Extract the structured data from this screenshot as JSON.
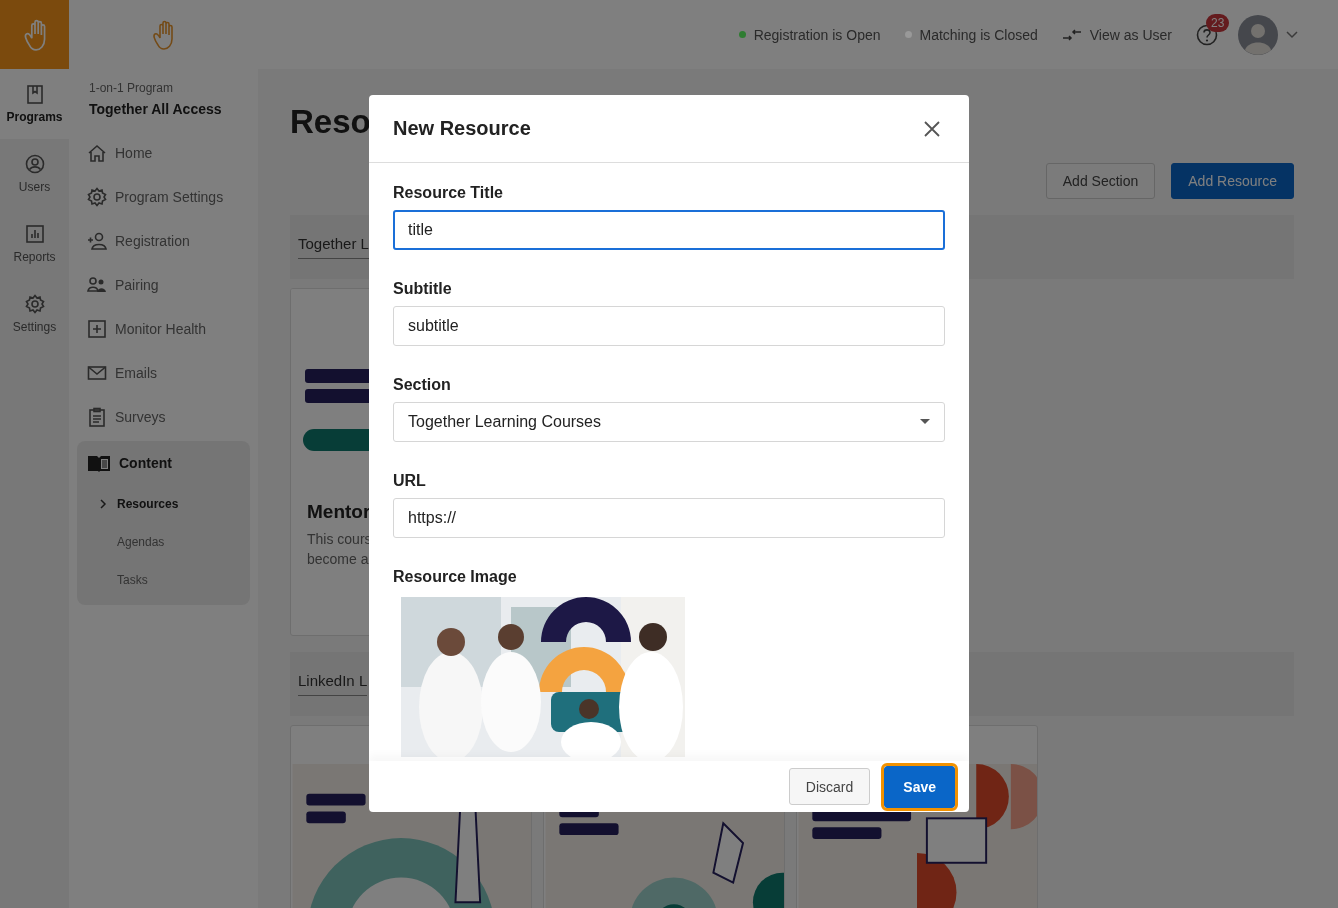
{
  "rail": {
    "items": [
      {
        "label": "Programs",
        "selected": true
      },
      {
        "label": "Users",
        "selected": false
      },
      {
        "label": "Reports",
        "selected": false
      },
      {
        "label": "Settings",
        "selected": false
      }
    ]
  },
  "nav": {
    "program_type": "1-on-1 Program",
    "program_name": "Together All Access",
    "items": [
      {
        "label": "Home",
        "selected": false
      },
      {
        "label": "Program Settings",
        "selected": false
      },
      {
        "label": "Registration",
        "selected": false
      },
      {
        "label": "Pairing",
        "selected": false
      },
      {
        "label": "Monitor Health",
        "selected": false
      },
      {
        "label": "Emails",
        "selected": false
      },
      {
        "label": "Surveys",
        "selected": false
      }
    ],
    "content_group": {
      "label": "Content",
      "expanded": true,
      "children": [
        {
          "label": "Resources",
          "selected": true
        },
        {
          "label": "Agendas",
          "selected": false
        },
        {
          "label": "Tasks",
          "selected": false
        }
      ]
    }
  },
  "topbar": {
    "statuses": [
      {
        "label": "Registration is Open",
        "color": "#2f7d32"
      },
      {
        "label": "Matching is Closed",
        "color": "#999999"
      }
    ],
    "view_as_user": "View as User",
    "help_badge": "23"
  },
  "main": {
    "title": "Reso",
    "buttons": [
      {
        "label": "Add Section",
        "kind": "secondary"
      },
      {
        "label": "Add Resource",
        "kind": "primary"
      }
    ],
    "sections": [
      {
        "title": "Together L",
        "cards": [
          {
            "kind": "course",
            "title": "Mentor",
            "description_lines": [
              "This cours",
              "become a"
            ]
          }
        ]
      },
      {
        "title": "LinkedIn L"
      }
    ]
  },
  "modal": {
    "title": "New Resource",
    "fields": [
      {
        "label": "Resource Title",
        "kind": "text",
        "value": "title",
        "focused": true
      },
      {
        "label": "Subtitle",
        "kind": "text",
        "value": "subtitle",
        "focused": false
      },
      {
        "label": "Section",
        "kind": "select",
        "value": "Together Learning Courses",
        "focused": false
      },
      {
        "label": "URL",
        "kind": "text",
        "value": "https://",
        "focused": false
      },
      {
        "label": "Resource Image"
      }
    ],
    "buttons": [
      {
        "label": "Discard",
        "kind": "secondary",
        "focused": false
      },
      {
        "label": "Save",
        "kind": "primary",
        "focused": true
      }
    ]
  }
}
